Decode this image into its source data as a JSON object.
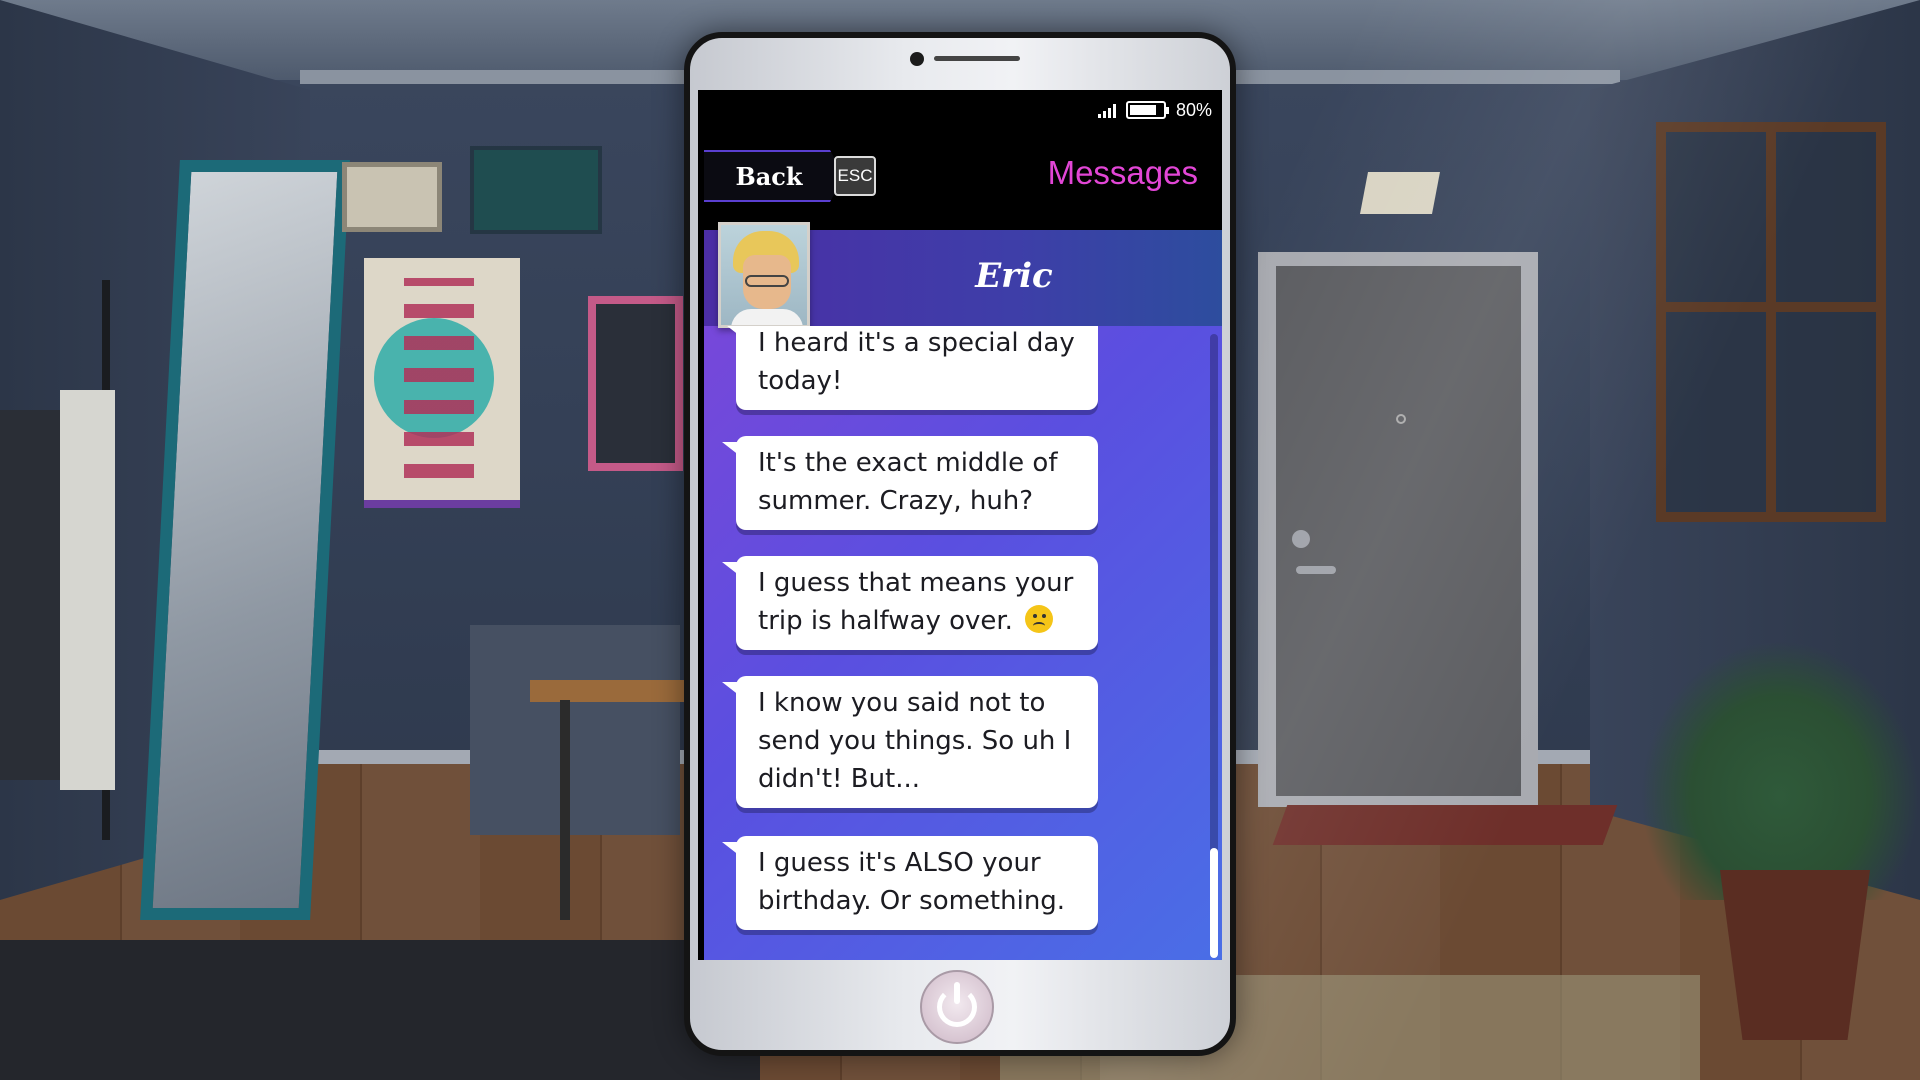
{
  "status_bar": {
    "battery_percent": "80%",
    "battery_level": 0.8,
    "signal_icon": "signal-bars-icon",
    "battery_icon": "battery-icon"
  },
  "nav": {
    "back_label": "Back",
    "esc_key": "ESC",
    "title": "Messages"
  },
  "chat": {
    "contact_name": "Eric",
    "messages": [
      "I heard it's a special day today!",
      "It's the exact middle of summer. Crazy, huh?",
      "I guess that means your trip is halfway over.",
      "I know you said not to send you things. So uh I didn't! But...",
      "I guess it's ALSO your birthday. Or something."
    ],
    "emoji_icon": "frowning-face-icon"
  },
  "colors": {
    "accent_title": "#e246d6",
    "chat_gradient_start": "#7d46d8",
    "chat_gradient_end": "#4a6ee6"
  }
}
